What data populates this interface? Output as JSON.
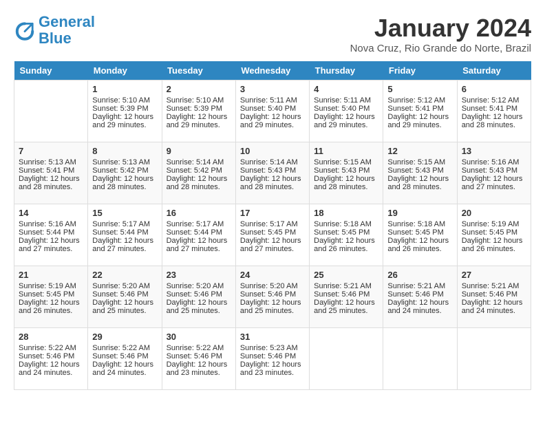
{
  "header": {
    "logo_line1": "General",
    "logo_line2": "Blue",
    "month_title": "January 2024",
    "location": "Nova Cruz, Rio Grande do Norte, Brazil"
  },
  "days_of_week": [
    "Sunday",
    "Monday",
    "Tuesday",
    "Wednesday",
    "Thursday",
    "Friday",
    "Saturday"
  ],
  "weeks": [
    [
      {
        "day": "",
        "data": []
      },
      {
        "day": "1",
        "sunrise": "Sunrise: 5:10 AM",
        "sunset": "Sunset: 5:39 PM",
        "daylight": "Daylight: 12 hours and 29 minutes."
      },
      {
        "day": "2",
        "sunrise": "Sunrise: 5:10 AM",
        "sunset": "Sunset: 5:39 PM",
        "daylight": "Daylight: 12 hours and 29 minutes."
      },
      {
        "day": "3",
        "sunrise": "Sunrise: 5:11 AM",
        "sunset": "Sunset: 5:40 PM",
        "daylight": "Daylight: 12 hours and 29 minutes."
      },
      {
        "day": "4",
        "sunrise": "Sunrise: 5:11 AM",
        "sunset": "Sunset: 5:40 PM",
        "daylight": "Daylight: 12 hours and 29 minutes."
      },
      {
        "day": "5",
        "sunrise": "Sunrise: 5:12 AM",
        "sunset": "Sunset: 5:41 PM",
        "daylight": "Daylight: 12 hours and 29 minutes."
      },
      {
        "day": "6",
        "sunrise": "Sunrise: 5:12 AM",
        "sunset": "Sunset: 5:41 PM",
        "daylight": "Daylight: 12 hours and 28 minutes."
      }
    ],
    [
      {
        "day": "7",
        "sunrise": "Sunrise: 5:13 AM",
        "sunset": "Sunset: 5:41 PM",
        "daylight": "Daylight: 12 hours and 28 minutes."
      },
      {
        "day": "8",
        "sunrise": "Sunrise: 5:13 AM",
        "sunset": "Sunset: 5:42 PM",
        "daylight": "Daylight: 12 hours and 28 minutes."
      },
      {
        "day": "9",
        "sunrise": "Sunrise: 5:14 AM",
        "sunset": "Sunset: 5:42 PM",
        "daylight": "Daylight: 12 hours and 28 minutes."
      },
      {
        "day": "10",
        "sunrise": "Sunrise: 5:14 AM",
        "sunset": "Sunset: 5:43 PM",
        "daylight": "Daylight: 12 hours and 28 minutes."
      },
      {
        "day": "11",
        "sunrise": "Sunrise: 5:15 AM",
        "sunset": "Sunset: 5:43 PM",
        "daylight": "Daylight: 12 hours and 28 minutes."
      },
      {
        "day": "12",
        "sunrise": "Sunrise: 5:15 AM",
        "sunset": "Sunset: 5:43 PM",
        "daylight": "Daylight: 12 hours and 28 minutes."
      },
      {
        "day": "13",
        "sunrise": "Sunrise: 5:16 AM",
        "sunset": "Sunset: 5:43 PM",
        "daylight": "Daylight: 12 hours and 27 minutes."
      }
    ],
    [
      {
        "day": "14",
        "sunrise": "Sunrise: 5:16 AM",
        "sunset": "Sunset: 5:44 PM",
        "daylight": "Daylight: 12 hours and 27 minutes."
      },
      {
        "day": "15",
        "sunrise": "Sunrise: 5:17 AM",
        "sunset": "Sunset: 5:44 PM",
        "daylight": "Daylight: 12 hours and 27 minutes."
      },
      {
        "day": "16",
        "sunrise": "Sunrise: 5:17 AM",
        "sunset": "Sunset: 5:44 PM",
        "daylight": "Daylight: 12 hours and 27 minutes."
      },
      {
        "day": "17",
        "sunrise": "Sunrise: 5:17 AM",
        "sunset": "Sunset: 5:45 PM",
        "daylight": "Daylight: 12 hours and 27 minutes."
      },
      {
        "day": "18",
        "sunrise": "Sunrise: 5:18 AM",
        "sunset": "Sunset: 5:45 PM",
        "daylight": "Daylight: 12 hours and 26 minutes."
      },
      {
        "day": "19",
        "sunrise": "Sunrise: 5:18 AM",
        "sunset": "Sunset: 5:45 PM",
        "daylight": "Daylight: 12 hours and 26 minutes."
      },
      {
        "day": "20",
        "sunrise": "Sunrise: 5:19 AM",
        "sunset": "Sunset: 5:45 PM",
        "daylight": "Daylight: 12 hours and 26 minutes."
      }
    ],
    [
      {
        "day": "21",
        "sunrise": "Sunrise: 5:19 AM",
        "sunset": "Sunset: 5:45 PM",
        "daylight": "Daylight: 12 hours and 26 minutes."
      },
      {
        "day": "22",
        "sunrise": "Sunrise: 5:20 AM",
        "sunset": "Sunset: 5:46 PM",
        "daylight": "Daylight: 12 hours and 25 minutes."
      },
      {
        "day": "23",
        "sunrise": "Sunrise: 5:20 AM",
        "sunset": "Sunset: 5:46 PM",
        "daylight": "Daylight: 12 hours and 25 minutes."
      },
      {
        "day": "24",
        "sunrise": "Sunrise: 5:20 AM",
        "sunset": "Sunset: 5:46 PM",
        "daylight": "Daylight: 12 hours and 25 minutes."
      },
      {
        "day": "25",
        "sunrise": "Sunrise: 5:21 AM",
        "sunset": "Sunset: 5:46 PM",
        "daylight": "Daylight: 12 hours and 25 minutes."
      },
      {
        "day": "26",
        "sunrise": "Sunrise: 5:21 AM",
        "sunset": "Sunset: 5:46 PM",
        "daylight": "Daylight: 12 hours and 24 minutes."
      },
      {
        "day": "27",
        "sunrise": "Sunrise: 5:21 AM",
        "sunset": "Sunset: 5:46 PM",
        "daylight": "Daylight: 12 hours and 24 minutes."
      }
    ],
    [
      {
        "day": "28",
        "sunrise": "Sunrise: 5:22 AM",
        "sunset": "Sunset: 5:46 PM",
        "daylight": "Daylight: 12 hours and 24 minutes."
      },
      {
        "day": "29",
        "sunrise": "Sunrise: 5:22 AM",
        "sunset": "Sunset: 5:46 PM",
        "daylight": "Daylight: 12 hours and 24 minutes."
      },
      {
        "day": "30",
        "sunrise": "Sunrise: 5:22 AM",
        "sunset": "Sunset: 5:46 PM",
        "daylight": "Daylight: 12 hours and 23 minutes."
      },
      {
        "day": "31",
        "sunrise": "Sunrise: 5:23 AM",
        "sunset": "Sunset: 5:46 PM",
        "daylight": "Daylight: 12 hours and 23 minutes."
      },
      {
        "day": "",
        "data": []
      },
      {
        "day": "",
        "data": []
      },
      {
        "day": "",
        "data": []
      }
    ]
  ]
}
